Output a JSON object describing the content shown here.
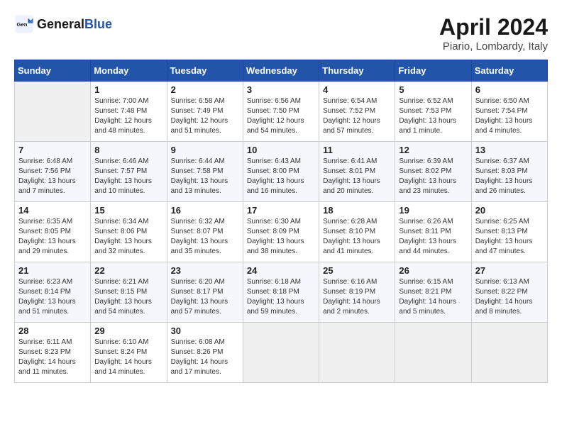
{
  "logo": {
    "text_general": "General",
    "text_blue": "Blue"
  },
  "header": {
    "title": "April 2024",
    "subtitle": "Piario, Lombardy, Italy"
  },
  "days_of_week": [
    "Sunday",
    "Monday",
    "Tuesday",
    "Wednesday",
    "Thursday",
    "Friday",
    "Saturday"
  ],
  "weeks": [
    [
      {
        "day": "",
        "sunrise": "",
        "sunset": "",
        "daylight": "",
        "empty": true
      },
      {
        "day": "1",
        "sunrise": "Sunrise: 7:00 AM",
        "sunset": "Sunset: 7:48 PM",
        "daylight": "Daylight: 12 hours and 48 minutes."
      },
      {
        "day": "2",
        "sunrise": "Sunrise: 6:58 AM",
        "sunset": "Sunset: 7:49 PM",
        "daylight": "Daylight: 12 hours and 51 minutes."
      },
      {
        "day": "3",
        "sunrise": "Sunrise: 6:56 AM",
        "sunset": "Sunset: 7:50 PM",
        "daylight": "Daylight: 12 hours and 54 minutes."
      },
      {
        "day": "4",
        "sunrise": "Sunrise: 6:54 AM",
        "sunset": "Sunset: 7:52 PM",
        "daylight": "Daylight: 12 hours and 57 minutes."
      },
      {
        "day": "5",
        "sunrise": "Sunrise: 6:52 AM",
        "sunset": "Sunset: 7:53 PM",
        "daylight": "Daylight: 13 hours and 1 minute."
      },
      {
        "day": "6",
        "sunrise": "Sunrise: 6:50 AM",
        "sunset": "Sunset: 7:54 PM",
        "daylight": "Daylight: 13 hours and 4 minutes."
      }
    ],
    [
      {
        "day": "7",
        "sunrise": "Sunrise: 6:48 AM",
        "sunset": "Sunset: 7:56 PM",
        "daylight": "Daylight: 13 hours and 7 minutes."
      },
      {
        "day": "8",
        "sunrise": "Sunrise: 6:46 AM",
        "sunset": "Sunset: 7:57 PM",
        "daylight": "Daylight: 13 hours and 10 minutes."
      },
      {
        "day": "9",
        "sunrise": "Sunrise: 6:44 AM",
        "sunset": "Sunset: 7:58 PM",
        "daylight": "Daylight: 13 hours and 13 minutes."
      },
      {
        "day": "10",
        "sunrise": "Sunrise: 6:43 AM",
        "sunset": "Sunset: 8:00 PM",
        "daylight": "Daylight: 13 hours and 16 minutes."
      },
      {
        "day": "11",
        "sunrise": "Sunrise: 6:41 AM",
        "sunset": "Sunset: 8:01 PM",
        "daylight": "Daylight: 13 hours and 20 minutes."
      },
      {
        "day": "12",
        "sunrise": "Sunrise: 6:39 AM",
        "sunset": "Sunset: 8:02 PM",
        "daylight": "Daylight: 13 hours and 23 minutes."
      },
      {
        "day": "13",
        "sunrise": "Sunrise: 6:37 AM",
        "sunset": "Sunset: 8:03 PM",
        "daylight": "Daylight: 13 hours and 26 minutes."
      }
    ],
    [
      {
        "day": "14",
        "sunrise": "Sunrise: 6:35 AM",
        "sunset": "Sunset: 8:05 PM",
        "daylight": "Daylight: 13 hours and 29 minutes."
      },
      {
        "day": "15",
        "sunrise": "Sunrise: 6:34 AM",
        "sunset": "Sunset: 8:06 PM",
        "daylight": "Daylight: 13 hours and 32 minutes."
      },
      {
        "day": "16",
        "sunrise": "Sunrise: 6:32 AM",
        "sunset": "Sunset: 8:07 PM",
        "daylight": "Daylight: 13 hours and 35 minutes."
      },
      {
        "day": "17",
        "sunrise": "Sunrise: 6:30 AM",
        "sunset": "Sunset: 8:09 PM",
        "daylight": "Daylight: 13 hours and 38 minutes."
      },
      {
        "day": "18",
        "sunrise": "Sunrise: 6:28 AM",
        "sunset": "Sunset: 8:10 PM",
        "daylight": "Daylight: 13 hours and 41 minutes."
      },
      {
        "day": "19",
        "sunrise": "Sunrise: 6:26 AM",
        "sunset": "Sunset: 8:11 PM",
        "daylight": "Daylight: 13 hours and 44 minutes."
      },
      {
        "day": "20",
        "sunrise": "Sunrise: 6:25 AM",
        "sunset": "Sunset: 8:13 PM",
        "daylight": "Daylight: 13 hours and 47 minutes."
      }
    ],
    [
      {
        "day": "21",
        "sunrise": "Sunrise: 6:23 AM",
        "sunset": "Sunset: 8:14 PM",
        "daylight": "Daylight: 13 hours and 51 minutes."
      },
      {
        "day": "22",
        "sunrise": "Sunrise: 6:21 AM",
        "sunset": "Sunset: 8:15 PM",
        "daylight": "Daylight: 13 hours and 54 minutes."
      },
      {
        "day": "23",
        "sunrise": "Sunrise: 6:20 AM",
        "sunset": "Sunset: 8:17 PM",
        "daylight": "Daylight: 13 hours and 57 minutes."
      },
      {
        "day": "24",
        "sunrise": "Sunrise: 6:18 AM",
        "sunset": "Sunset: 8:18 PM",
        "daylight": "Daylight: 13 hours and 59 minutes."
      },
      {
        "day": "25",
        "sunrise": "Sunrise: 6:16 AM",
        "sunset": "Sunset: 8:19 PM",
        "daylight": "Daylight: 14 hours and 2 minutes."
      },
      {
        "day": "26",
        "sunrise": "Sunrise: 6:15 AM",
        "sunset": "Sunset: 8:21 PM",
        "daylight": "Daylight: 14 hours and 5 minutes."
      },
      {
        "day": "27",
        "sunrise": "Sunrise: 6:13 AM",
        "sunset": "Sunset: 8:22 PM",
        "daylight": "Daylight: 14 hours and 8 minutes."
      }
    ],
    [
      {
        "day": "28",
        "sunrise": "Sunrise: 6:11 AM",
        "sunset": "Sunset: 8:23 PM",
        "daylight": "Daylight: 14 hours and 11 minutes."
      },
      {
        "day": "29",
        "sunrise": "Sunrise: 6:10 AM",
        "sunset": "Sunset: 8:24 PM",
        "daylight": "Daylight: 14 hours and 14 minutes."
      },
      {
        "day": "30",
        "sunrise": "Sunrise: 6:08 AM",
        "sunset": "Sunset: 8:26 PM",
        "daylight": "Daylight: 14 hours and 17 minutes."
      },
      {
        "day": "",
        "sunrise": "",
        "sunset": "",
        "daylight": "",
        "empty": true
      },
      {
        "day": "",
        "sunrise": "",
        "sunset": "",
        "daylight": "",
        "empty": true
      },
      {
        "day": "",
        "sunrise": "",
        "sunset": "",
        "daylight": "",
        "empty": true
      },
      {
        "day": "",
        "sunrise": "",
        "sunset": "",
        "daylight": "",
        "empty": true
      }
    ]
  ]
}
